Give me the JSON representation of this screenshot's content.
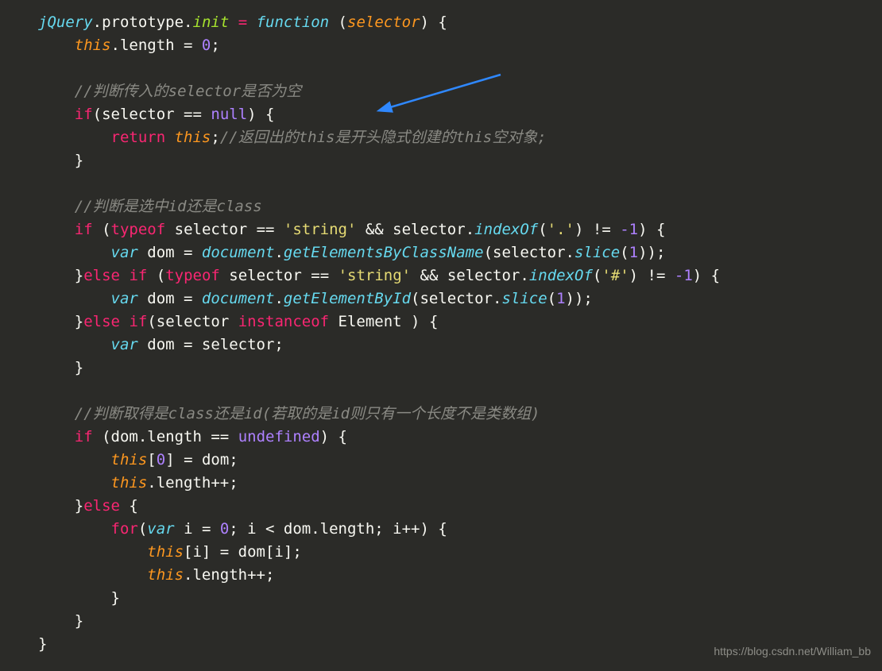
{
  "watermark": "https://blog.csdn.net/William_bb",
  "code": {
    "l1": {
      "a": "jQuery",
      "b": ".",
      "c": "prototype",
      "d": ".",
      "e": "init",
      "f": " = ",
      "g": "function",
      "h": " (",
      "i": "selector",
      "j": ") {"
    },
    "l2": {
      "a": "this",
      "b": ".length = ",
      "c": "0",
      "d": ";"
    },
    "l3": {
      "a": "//判断传入的selector是否为空"
    },
    "l4": {
      "a": "if",
      "b": "(selector == ",
      "c": "null",
      "d": ") {"
    },
    "l5": {
      "a": "return",
      "b": " ",
      "c": "this",
      "d": ";",
      "e": "//返回出的this是开头隐式创建的this空对象;"
    },
    "l6": {
      "a": "}"
    },
    "l7": {
      "a": "//判断是选中id还是class"
    },
    "l8": {
      "a": "if",
      "b": " (",
      "c": "typeof",
      "d": " selector == ",
      "e": "'string'",
      "f": " && selector.",
      "g": "indexOf",
      "h": "(",
      "i": "'.'",
      "j": ") != ",
      "k": "-1",
      "l": ") {"
    },
    "l9": {
      "a": "var",
      "b": " dom = ",
      "c": "document",
      "d": ".",
      "e": "getElementsByClassName",
      "f": "(selector.",
      "g": "slice",
      "h": "(",
      "i": "1",
      "j": "));"
    },
    "l10": {
      "a": "}",
      "b": "else",
      "c": " ",
      "d": "if",
      "e": " (",
      "f": "typeof",
      "g": " selector == ",
      "h": "'string'",
      "i": " && selector.",
      "j": "indexOf",
      "k": "(",
      "l": "'#'",
      "m": ") != ",
      "n": "-1",
      "o": ") {"
    },
    "l11": {
      "a": "var",
      "b": " dom = ",
      "c": "document",
      "d": ".",
      "e": "getElementById",
      "f": "(selector.",
      "g": "slice",
      "h": "(",
      "i": "1",
      "j": "));"
    },
    "l12": {
      "a": "}",
      "b": "else",
      "c": " ",
      "d": "if",
      "e": "(selector ",
      "f": "instanceof",
      "g": " Element ) {"
    },
    "l13": {
      "a": "var",
      "b": " dom = selector;"
    },
    "l14": {
      "a": "}"
    },
    "l15": {
      "a": "//判断取得是class还是id(若取的是id则只有一个长度不是类数组)"
    },
    "l16": {
      "a": "if",
      "b": " (dom.length == ",
      "c": "undefined",
      "d": ") {"
    },
    "l17": {
      "a": "this",
      "b": "[",
      "c": "0",
      "d": "] = dom;"
    },
    "l18": {
      "a": "this",
      "b": ".length++;"
    },
    "l19": {
      "a": "}",
      "b": "else",
      "c": " {"
    },
    "l20": {
      "a": "for",
      "b": "(",
      "c": "var",
      "d": " i = ",
      "e": "0",
      "f": "; i < dom.length; i++) {"
    },
    "l21": {
      "a": "this",
      "b": "[i] = dom[i];"
    },
    "l22": {
      "a": "this",
      "b": ".length++;"
    },
    "l23": {
      "a": "}"
    },
    "l24": {
      "a": "}"
    },
    "l25": {
      "a": "}"
    }
  }
}
